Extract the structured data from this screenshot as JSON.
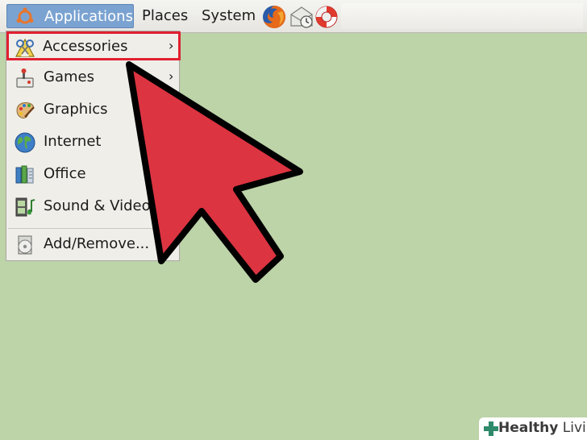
{
  "panel": {
    "menus": [
      {
        "label": "Applications"
      },
      {
        "label": "Places"
      },
      {
        "label": "System"
      }
    ]
  },
  "applications_menu": {
    "items": [
      {
        "label": "Accessories",
        "icon": "accessories-icon",
        "has_submenu": true,
        "highlighted": true
      },
      {
        "label": "Games",
        "icon": "games-icon",
        "has_submenu": true
      },
      {
        "label": "Graphics",
        "icon": "graphics-icon",
        "has_submenu": false
      },
      {
        "label": "Internet",
        "icon": "internet-icon",
        "has_submenu": false
      },
      {
        "label": "Office",
        "icon": "office-icon",
        "has_submenu": false
      },
      {
        "label": "Sound & Video",
        "icon": "sound-video-icon",
        "has_submenu": false
      },
      {
        "label": "Add/Remove...",
        "icon": "add-remove-icon",
        "has_submenu": false
      }
    ],
    "submenu_arrow": "›"
  },
  "watermark": {
    "brand_bold": "Healthy",
    "brand_rest": " Living"
  },
  "colors": {
    "desktop": "#bdd3a8",
    "menu_active": "#7ba3d1",
    "highlight_border": "#e02030",
    "arrow_fill": "#dc3441"
  }
}
